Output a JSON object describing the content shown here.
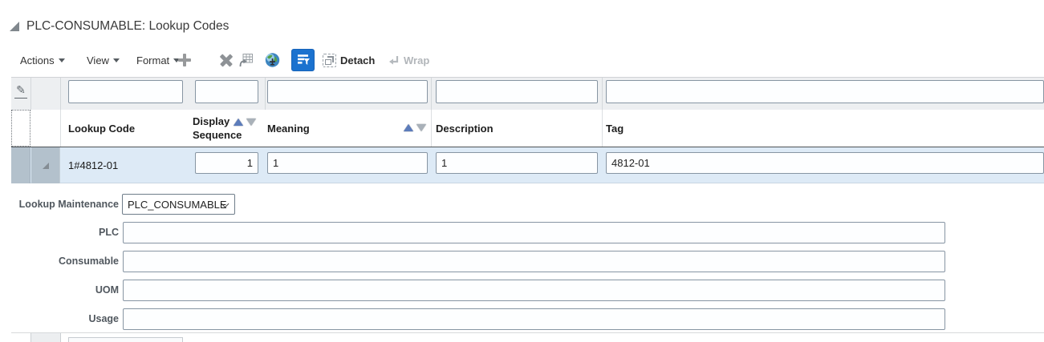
{
  "panel": {
    "title": "PLC-CONSUMABLE: Lookup Codes"
  },
  "toolbar": {
    "menus": [
      {
        "label": "Actions"
      },
      {
        "label": "View"
      },
      {
        "label": "Format"
      }
    ],
    "icon_buttons": [
      {
        "name": "add",
        "icon": "plus-icon"
      },
      {
        "name": "delete",
        "icon": "x-icon"
      },
      {
        "name": "export-table",
        "icon": "table-arrow-icon"
      },
      {
        "name": "globe",
        "icon": "globe-icon"
      },
      {
        "name": "query-by-example",
        "icon": "filter-table-icon",
        "active": true
      }
    ],
    "detach": {
      "label": "Detach"
    },
    "wrap": {
      "label": "Wrap",
      "disabled": true
    }
  },
  "table": {
    "columns": [
      {
        "label": "Lookup Code",
        "sortable": false
      },
      {
        "label": "Display Sequence",
        "sortable": true
      },
      {
        "label": "Meaning",
        "sortable": true
      },
      {
        "label": "Description",
        "sortable": false
      },
      {
        "label": "Tag",
        "sortable": false
      }
    ],
    "filter_row": {
      "values": [
        "",
        "",
        "",
        "",
        ""
      ]
    },
    "rows": [
      {
        "selected": true,
        "lookup_code": "1#4812-01",
        "display_sequence": "1",
        "meaning": "1",
        "description": "1",
        "tag": "4812-01"
      }
    ]
  },
  "form": {
    "fields": [
      {
        "label": "Lookup Maintenance",
        "type": "select",
        "value": "PLC_CONSUMABLE"
      },
      {
        "label": "PLC",
        "type": "text",
        "value": ""
      },
      {
        "label": "Consumable",
        "type": "text",
        "value": ""
      },
      {
        "label": "UOM",
        "type": "text",
        "value": ""
      },
      {
        "label": "Usage",
        "type": "text",
        "value": ""
      }
    ]
  },
  "colors": {
    "accent_blue": "#1b72cf",
    "selected_row_bg": "#ddeaf6",
    "row_header_bg": "#b3c1cc",
    "filter_row_bg": "#edeff1",
    "sort_active": "#5c7cbb",
    "sort_inactive": "#a9b1b9"
  }
}
